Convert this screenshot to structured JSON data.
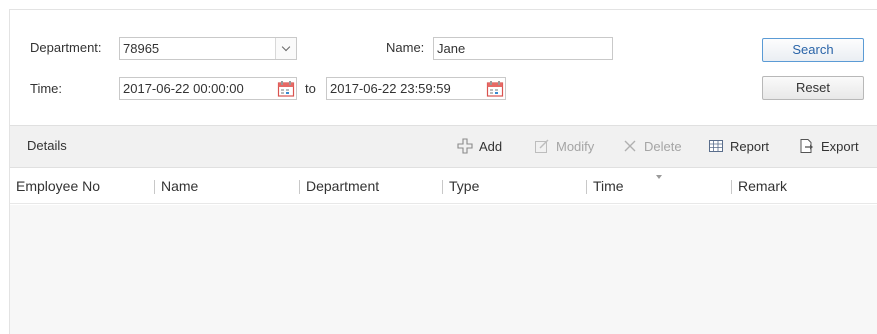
{
  "filter": {
    "department_label": "Department:",
    "department_value": "78965",
    "name_label": "Name:",
    "name_value": "Jane",
    "time_label": "Time:",
    "time_from": "2017-06-22 00:00:00",
    "time_to_label": "to",
    "time_to": "2017-06-22 23:59:59",
    "search_label": "Search",
    "reset_label": "Reset"
  },
  "details": {
    "title": "Details",
    "add_label": "Add",
    "modify_label": "Modify",
    "delete_label": "Delete",
    "report_label": "Report",
    "export_label": "Export"
  },
  "table": {
    "columns": [
      "Employee No",
      "Name",
      "Department",
      "Type",
      "Time",
      "Remark"
    ],
    "rows": []
  },
  "icons": {
    "department_dropdown": "chevron-down-icon",
    "calendar": "calendar-icon",
    "add": "plus-icon",
    "modify": "edit-icon",
    "delete": "close-icon",
    "report": "report-icon",
    "export": "export-icon"
  },
  "colors": {
    "primary_button_border": "#5b9bd5",
    "primary_button_text": "#2a64a8",
    "calendar_accent": "#d9534f",
    "details_bar": "#f1f1f1",
    "table_body": "#f7f7f7"
  }
}
